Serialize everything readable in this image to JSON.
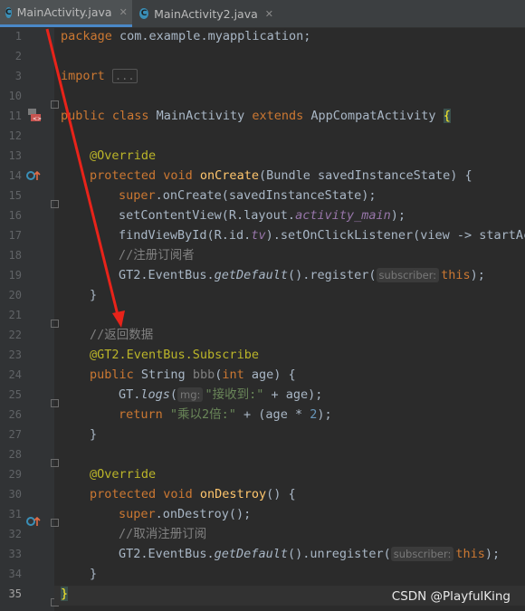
{
  "tabs": [
    {
      "label": "MainActivity.java",
      "icon": "C",
      "active": true
    },
    {
      "label": "MainActivity2.java",
      "icon": "C",
      "active": false
    }
  ],
  "close_glyph": "✕",
  "line_numbers": [
    "1",
    "2",
    "3",
    "10",
    "11",
    "12",
    "13",
    "14",
    "15",
    "16",
    "17",
    "18",
    "19",
    "20",
    "21",
    "22",
    "23",
    "24",
    "25",
    "26",
    "27",
    "28",
    "29",
    "30",
    "31",
    "32",
    "33",
    "34",
    "35"
  ],
  "current_line": "35",
  "code": {
    "l1_kw": "package",
    "l1_rest": " com.example.myapplication;",
    "l3_kw": "import",
    "l3_fold": "...",
    "l11_kw": "public class",
    "l11_name": " MainActivity ",
    "l11_kw2": "extends",
    "l11_rest": " AppCompatActivity ",
    "l11_brace": "{",
    "l13_ann": "@Override",
    "l14_kw": "protected void",
    "l14_fn": " onCreate",
    "l14_rest": "(Bundle savedInstanceState) {",
    "l15_kw": "super",
    "l15_rest": ".onCreate(savedInstanceState);",
    "l16_a": "setContentView(R.layout.",
    "l16_field": "activity_main",
    "l16_b": ");",
    "l17_a": "findViewById(R.id.",
    "l17_field": "tv",
    "l17_b": ").setOnClickListener(view -> startAc",
    "l18_cmt": "//注册订阅者",
    "l19_a": "GT2.EventBus.",
    "l19_it": "getDefault",
    "l19_b": "().register(",
    "l19_hint": "subscriber:",
    "l19_kw": "this",
    "l19_c": ");",
    "l20": "}",
    "l22_cmt": "//返回数据",
    "l23_a": "@GT2.EventBus.",
    "l23_b": "Subscribe",
    "l24_kw": "public",
    "l24_a": " String ",
    "l24_name": "bbb",
    "l24_b": "(",
    "l24_kw2": "int",
    "l24_c": " age) {",
    "l25_a": "GT.",
    "l25_it": "logs",
    "l25_b": "(",
    "l25_hint": "mg:",
    "l25_str": "\"接收到:\"",
    "l25_c": " + age);",
    "l26_kw": "return",
    "l26_str": " \"乘以2倍:\"",
    "l26_a": " + (age * ",
    "l26_num": "2",
    "l26_b": ");",
    "l27": "}",
    "l29_ann": "@Override",
    "l30_kw": "protected void",
    "l30_fn": " onDestroy",
    "l30_rest": "() {",
    "l31_kw": "super",
    "l31_rest": ".onDestroy();",
    "l32_cmt": "//取消注册订阅",
    "l33_a": "GT2.EventBus.",
    "l33_it": "getDefault",
    "l33_b": "().unregister(",
    "l33_hint": "subscriber:",
    "l33_kw": "this",
    "l33_c": ");",
    "l34": "}",
    "l35": "}"
  },
  "watermark": "CSDN @PlayfulKing",
  "colors": {
    "annotation_arrow": "#e8231a",
    "tab_accent": "#4a88c7"
  }
}
